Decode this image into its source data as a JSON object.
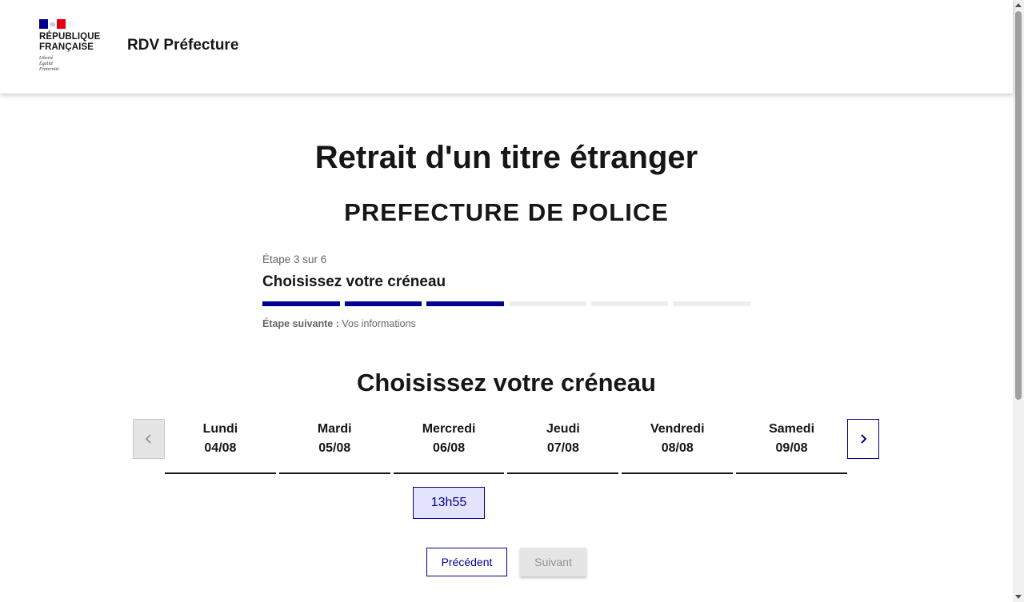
{
  "header": {
    "logo": {
      "line1": "RÉPUBLIQUE",
      "line2": "FRANÇAISE",
      "motto1": "Liberté",
      "motto2": "Égalité",
      "motto3": "Fraternité"
    },
    "service_name": "RDV Préfecture"
  },
  "main": {
    "title": "Retrait d'un titre étranger",
    "subtitle": "PREFECTURE DE POLICE",
    "stepper": {
      "state": "Étape 3 sur 6",
      "current_title": "Choisissez votre créneau",
      "current_step": 3,
      "total_steps": 6,
      "next_label": "Étape suivante :",
      "next_value": " Vos informations"
    },
    "slot_section_title": "Choisissez votre créneau",
    "calendar": {
      "days": [
        {
          "name": "Lundi",
          "date": "04/08"
        },
        {
          "name": "Mardi",
          "date": "05/08"
        },
        {
          "name": "Mercredi",
          "date": "06/08"
        },
        {
          "name": "Jeudi",
          "date": "07/08"
        },
        {
          "name": "Vendredi",
          "date": "08/08"
        },
        {
          "name": "Samedi",
          "date": "09/08"
        }
      ],
      "slots": [
        {
          "day": "Mercredi 06/08",
          "time": "13h55",
          "selected": true
        }
      ]
    },
    "buttons": {
      "previous": "Précédent",
      "next": "Suivant"
    }
  },
  "colors": {
    "primary": "#000091",
    "slot_bg": "#e3e3fd",
    "disabled_bg": "#e5e5e5",
    "disabled_text": "#929292",
    "flag_red": "#e1000f"
  },
  "icons": {
    "prev": "chevron-left-icon",
    "next": "chevron-right-icon"
  }
}
